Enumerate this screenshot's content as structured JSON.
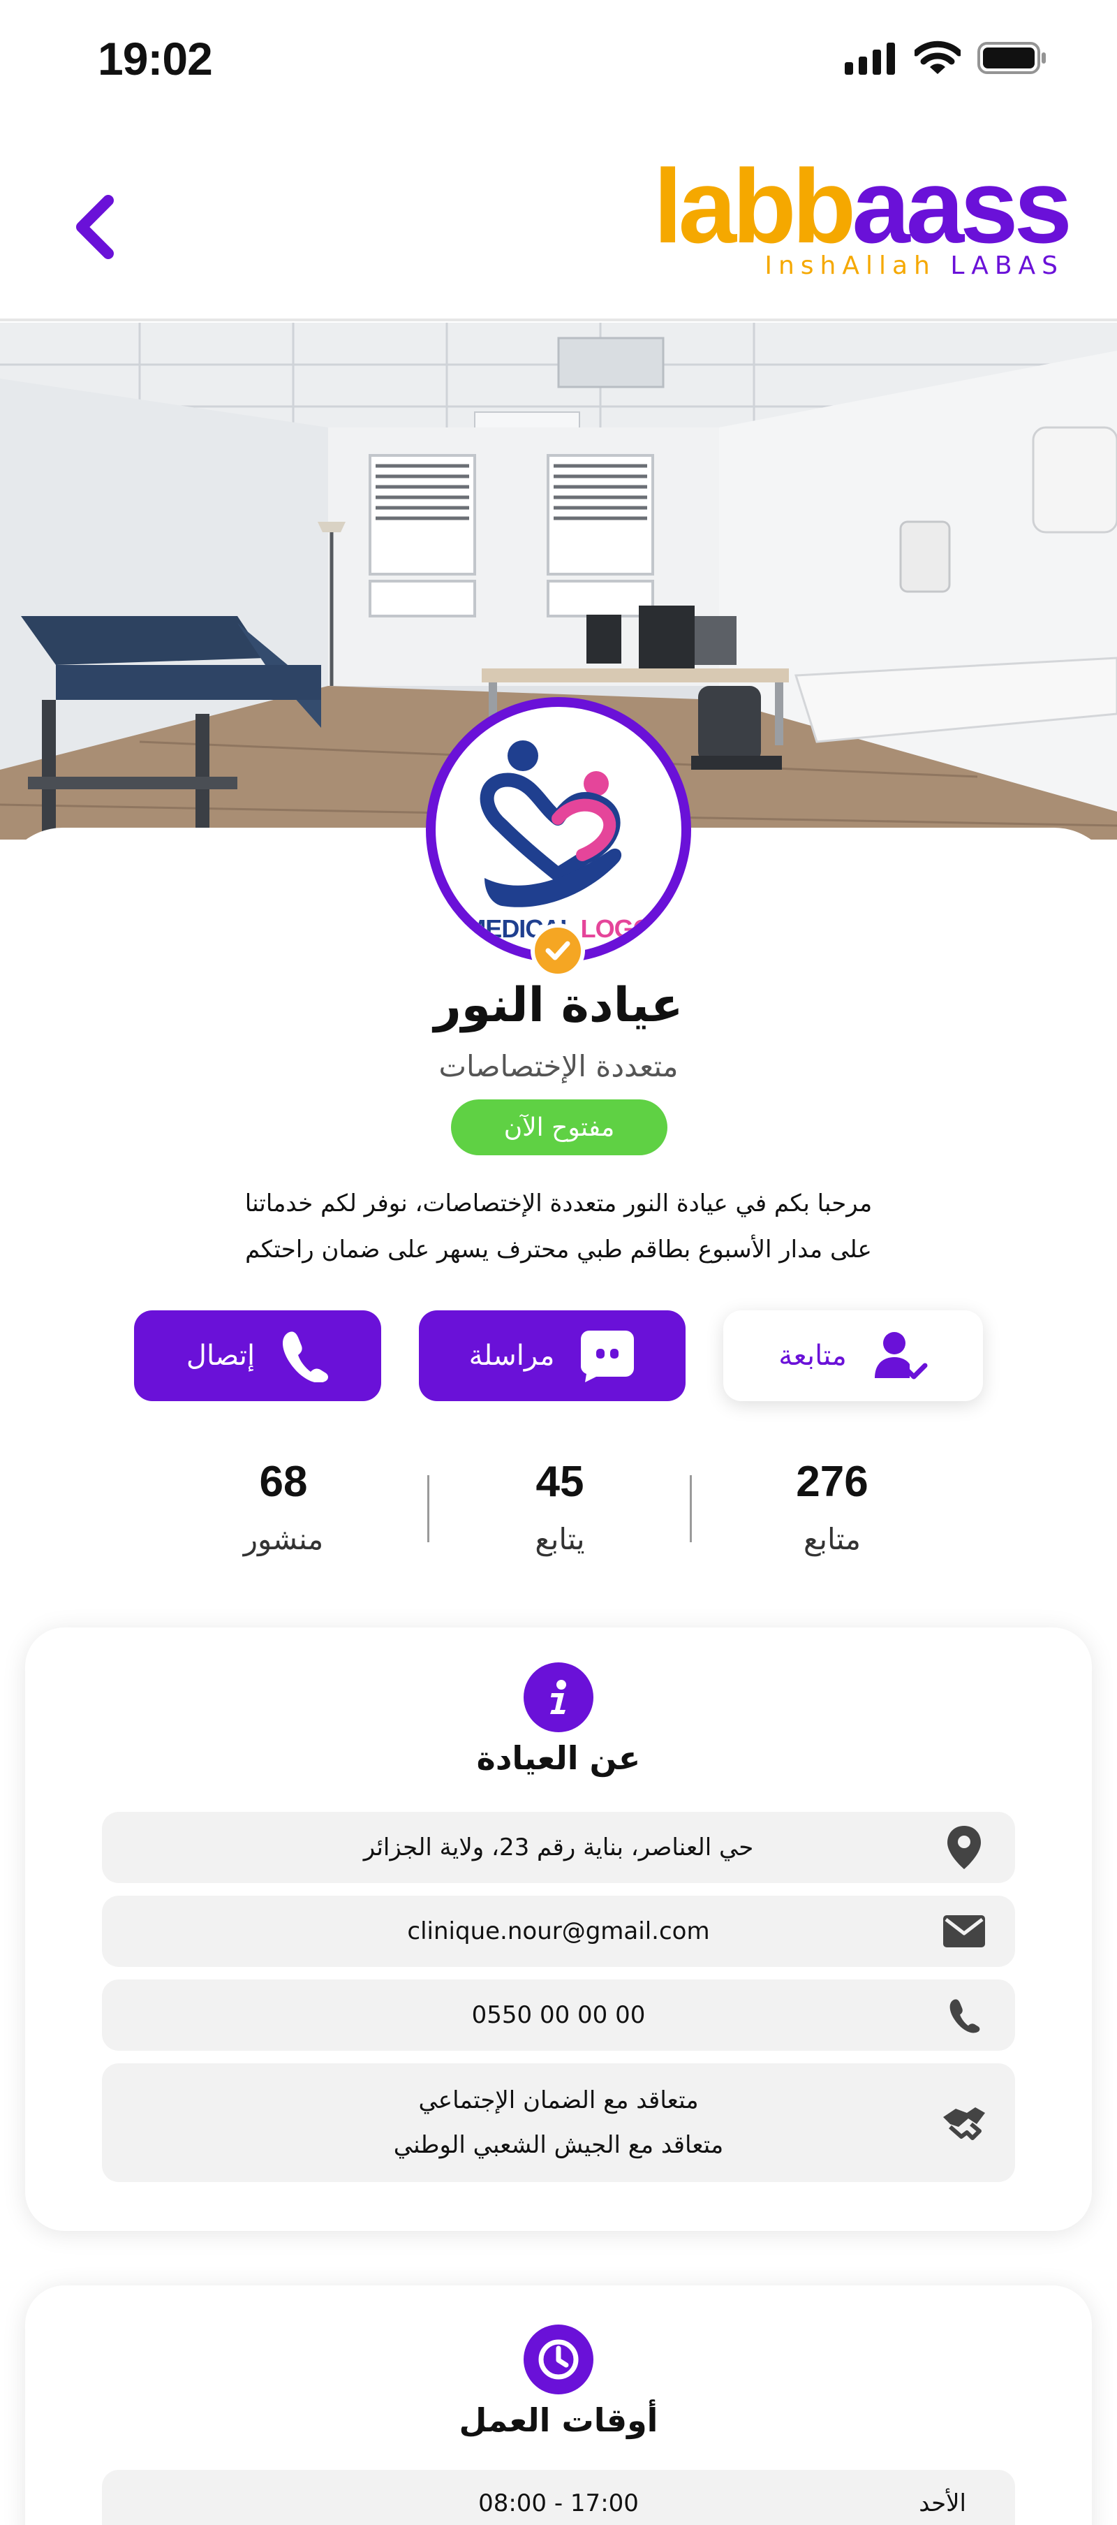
{
  "status_bar": {
    "time": "19:02"
  },
  "header": {
    "logo_word_part1": "labb",
    "logo_word_part2": "aass",
    "logo_tagline_part1": "InshAllah",
    "logo_tagline_part2": "LABAS"
  },
  "profile": {
    "avatar_logo_part1": "MEDICAL",
    "avatar_logo_part2": "LOGO",
    "name": "عيادة النور",
    "type": "متعددة الإختصاصات",
    "open_status": "مفتوح الآن",
    "description_line1": "مرحبا بكم في عيادة النور متعددة الإختصاصات، نوفر لكم خدماتنا",
    "description_line2": "على مدار الأسبوع بطاقم طبي محترف يسهر على ضمان راحتكم"
  },
  "actions": {
    "follow_label": "متابعة",
    "message_label": "مراسلة",
    "call_label": "إتصال"
  },
  "stats": [
    {
      "value": "276",
      "label": "متابع"
    },
    {
      "value": "45",
      "label": "يتابع"
    },
    {
      "value": "68",
      "label": "منشور"
    }
  ],
  "about": {
    "title": "عن العيادة",
    "address": "حي العناصر، بناية رقم 23، ولاية الجزائر",
    "email": "clinique.nour@gmail.com",
    "phone": "0550 00 00 00",
    "agreement_line1": "متعاقد مع الضمان الإجتماعي",
    "agreement_line2": "متعاقد مع الجيش الشعبي الوطني"
  },
  "hours": {
    "title": "أوقات العمل",
    "rows": [
      {
        "day": "الأحد",
        "time": "08:00 - 17:00"
      }
    ]
  },
  "colors": {
    "brand_purple": "#6a11d8",
    "brand_orange": "#f5a800",
    "open_green": "#5fd144",
    "verified_orange": "#f5a623"
  }
}
